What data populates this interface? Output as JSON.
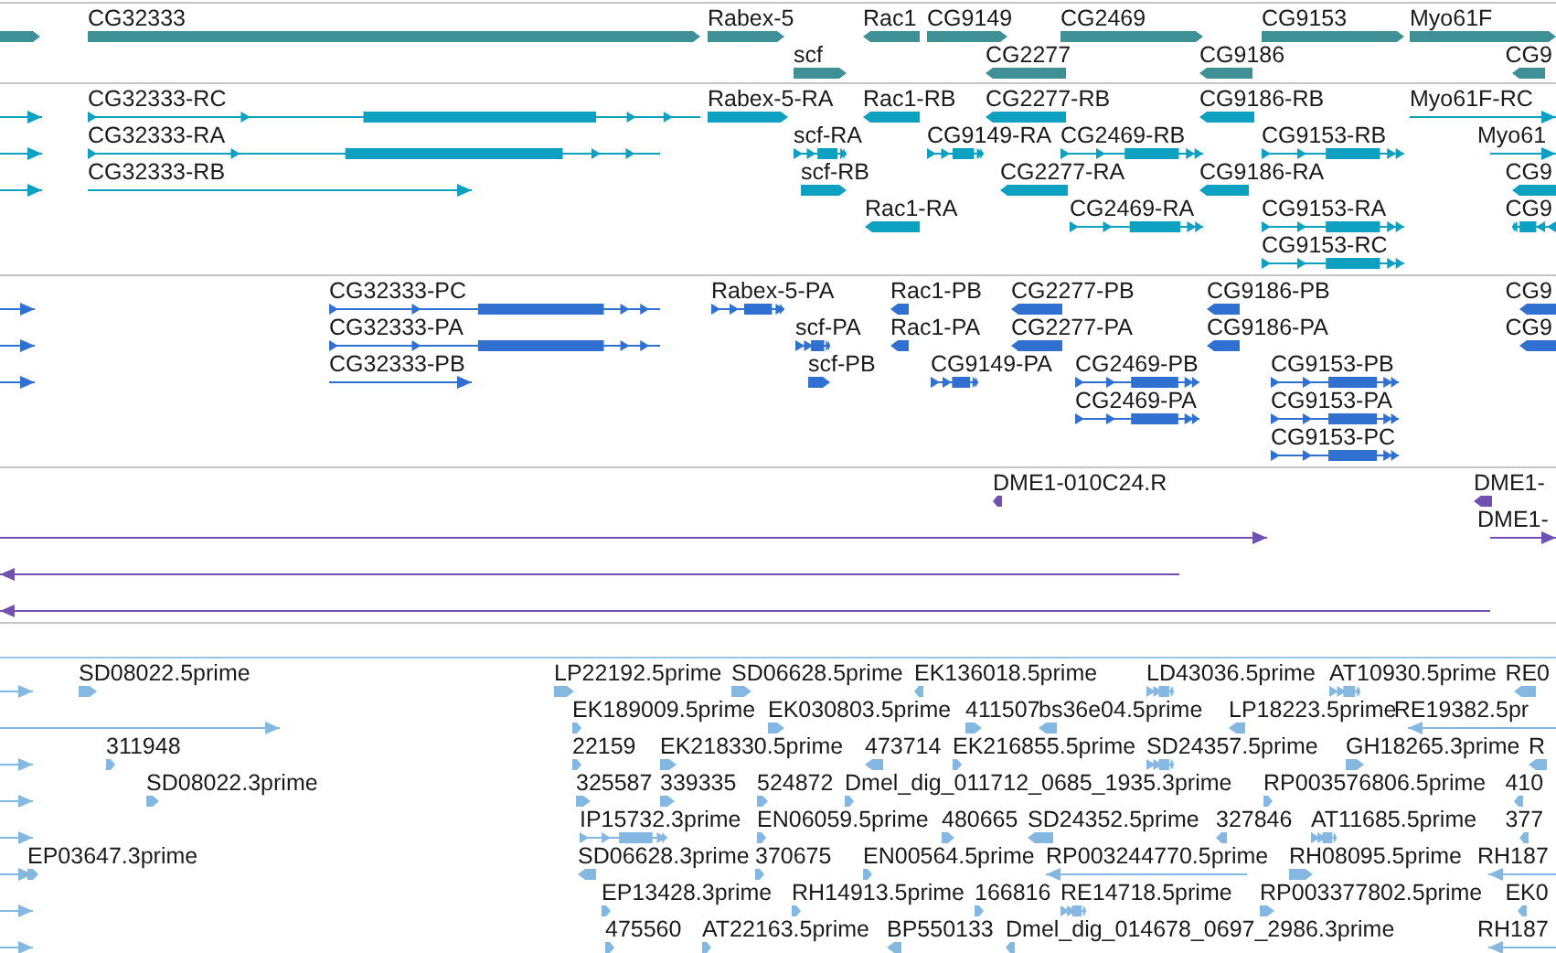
{
  "tracks": [
    {
      "color": "#3f8f96",
      "rows": [
        {
          "features": [
            {
              "kind": "block",
              "reverse": false
            },
            {
              "label": "CG32333",
              "kind": "block",
              "reverse": false
            },
            {
              "label": "Rabex-5",
              "kind": "block",
              "reverse": false
            },
            {
              "label": "Rac1",
              "kind": "block",
              "reverse": true
            },
            {
              "label": "CG9149",
              "kind": "block",
              "reverse": false
            },
            {
              "label": "CG2469",
              "kind": "block",
              "reverse": false
            },
            {
              "label": "CG9153",
              "kind": "block",
              "reverse": false
            },
            {
              "label": "Myo61F",
              "kind": "block",
              "reverse": false
            }
          ]
        },
        {
          "features": [
            {
              "label": "scf",
              "kind": "block",
              "reverse": false
            },
            {
              "label": "CG2277",
              "kind": "block",
              "reverse": true
            },
            {
              "label": "CG9186",
              "kind": "block",
              "reverse": true
            },
            {
              "label": "CG9",
              "kind": "block",
              "reverse": true
            }
          ]
        }
      ]
    },
    {
      "color": "#0ea0c0",
      "rows": [
        {
          "features": [
            {
              "kind": "line",
              "reverse": false
            },
            {
              "label": "CG32333-RC",
              "kind": "spliced",
              "reverse": false
            },
            {
              "label": "Rabex-5-RA",
              "kind": "block",
              "reverse": false
            },
            {
              "label": "Rac1-RB",
              "kind": "block",
              "reverse": true
            },
            {
              "label": "CG2277-RB",
              "kind": "block",
              "reverse": true
            },
            {
              "label": "CG9186-RB",
              "kind": "block",
              "reverse": true
            },
            {
              "label": "Myo61F-RC",
              "kind": "line",
              "reverse": false
            }
          ]
        },
        {
          "features": [
            {
              "kind": "line",
              "reverse": false
            },
            {
              "label": "CG32333-RA",
              "kind": "spliced",
              "reverse": false
            },
            {
              "label": "scf-RA",
              "kind": "spliced",
              "reverse": false
            },
            {
              "label": "CG9149-RA",
              "kind": "spliced",
              "reverse": false
            },
            {
              "label": "CG2469-RB",
              "kind": "spliced",
              "reverse": false
            },
            {
              "label": "CG9153-RB",
              "kind": "spliced",
              "reverse": false
            },
            {
              "label": "Myo61",
              "kind": "line",
              "reverse": false
            }
          ]
        },
        {
          "features": [
            {
              "kind": "line",
              "reverse": false
            },
            {
              "label": "CG32333-RB",
              "kind": "line",
              "reverse": false
            },
            {
              "label": "scf-RB",
              "kind": "block",
              "reverse": false
            },
            {
              "label": "CG2277-RA",
              "kind": "block",
              "reverse": true
            },
            {
              "label": "CG9186-RA",
              "kind": "block",
              "reverse": true
            },
            {
              "label": "CG9",
              "kind": "block",
              "reverse": true
            }
          ]
        },
        {
          "features": [
            {
              "label": "Rac1-RA",
              "kind": "block",
              "reverse": true
            },
            {
              "label": "CG2469-RA",
              "kind": "spliced",
              "reverse": false
            },
            {
              "label": "CG9153-RA",
              "kind": "spliced",
              "reverse": false
            },
            {
              "label": "CG9",
              "kind": "spliced",
              "reverse": true
            }
          ]
        },
        {
          "features": [
            {
              "label": "CG9153-RC",
              "kind": "spliced",
              "reverse": false
            }
          ]
        }
      ]
    },
    {
      "color": "#3070d0",
      "rows": [
        {
          "features": [
            {
              "kind": "line",
              "reverse": false
            },
            {
              "label": "CG32333-PC",
              "kind": "spliced",
              "reverse": false
            },
            {
              "label": "Rabex-5-PA",
              "kind": "spliced",
              "reverse": false
            },
            {
              "label": "Rac1-PB",
              "kind": "block",
              "reverse": true
            },
            {
              "label": "CG2277-PB",
              "kind": "block",
              "reverse": true
            },
            {
              "label": "CG9186-PB",
              "kind": "block",
              "reverse": true
            },
            {
              "label": "CG9",
              "kind": "block",
              "reverse": true
            }
          ]
        },
        {
          "features": [
            {
              "kind": "line",
              "reverse": false
            },
            {
              "label": "CG32333-PA",
              "kind": "spliced",
              "reverse": false
            },
            {
              "label": "scf-PA",
              "kind": "spliced",
              "reverse": false
            },
            {
              "label": "Rac1-PA",
              "kind": "block",
              "reverse": true
            },
            {
              "label": "CG2277-PA",
              "kind": "block",
              "reverse": true
            },
            {
              "label": "CG9186-PA",
              "kind": "block",
              "reverse": true
            },
            {
              "label": "CG9",
              "kind": "block",
              "reverse": true
            }
          ]
        },
        {
          "features": [
            {
              "kind": "line",
              "reverse": false
            },
            {
              "label": "CG32333-PB",
              "kind": "line",
              "reverse": false
            },
            {
              "label": "scf-PB",
              "kind": "block",
              "reverse": false
            },
            {
              "label": "CG9149-PA",
              "kind": "spliced",
              "reverse": false
            },
            {
              "label": "CG2469-PB",
              "kind": "spliced",
              "reverse": false
            },
            {
              "label": "CG9153-PB",
              "kind": "spliced",
              "reverse": false
            }
          ]
        },
        {
          "features": [
            {
              "label": "CG2469-PA",
              "kind": "spliced",
              "reverse": false
            },
            {
              "label": "CG9153-PA",
              "kind": "spliced",
              "reverse": false
            }
          ]
        },
        {
          "features": [
            {
              "label": "CG9153-PC",
              "kind": "spliced",
              "reverse": false
            }
          ]
        }
      ]
    },
    {
      "color": "#7050b0",
      "rows": [
        {
          "features": [
            {
              "label": "DME1-010C24.R",
              "kind": "block",
              "reverse": true
            },
            {
              "label": "DME1-",
              "kind": "block",
              "reverse": true
            }
          ]
        },
        {
          "features": [
            {
              "kind": "line",
              "reverse": false
            },
            {
              "label": "DME1-",
              "kind": "line",
              "reverse": false
            }
          ]
        },
        {
          "features": [
            {
              "kind": "line",
              "reverse": true
            }
          ]
        },
        {
          "features": [
            {
              "kind": "line",
              "reverse": true
            }
          ]
        }
      ]
    },
    {
      "color": "#84b8e0",
      "rows": [
        {
          "features": [
            {
              "kind": "line",
              "reverse": false
            },
            {
              "label": "SD08022.5prime",
              "kind": "block",
              "reverse": false
            },
            {
              "label": "LP22192.5prime",
              "kind": "block",
              "reverse": false
            },
            {
              "label": "SD06628.5prime",
              "kind": "block",
              "reverse": false
            },
            {
              "label": "EK136018.5prime",
              "kind": "block",
              "reverse": true
            },
            {
              "label": "LD43036.5prime",
              "kind": "spliced",
              "reverse": false
            },
            {
              "label": "AT10930.5prime",
              "kind": "spliced",
              "reverse": false
            },
            {
              "label": "RE0",
              "kind": "block",
              "reverse": true
            }
          ]
        },
        {
          "features": [
            {
              "kind": "line",
              "reverse": false
            },
            {
              "label": "EK189009.5prime",
              "kind": "block",
              "reverse": false
            },
            {
              "label": "EK030803.5prime",
              "kind": "block",
              "reverse": false
            },
            {
              "label": "411507",
              "kind": "block",
              "reverse": false
            },
            {
              "label": "bs36e04.5prime",
              "kind": "block",
              "reverse": true
            },
            {
              "label": "LP18223.5prime",
              "kind": "block",
              "reverse": true
            },
            {
              "label": "RE19382.5pr",
              "kind": "line",
              "reverse": true
            }
          ]
        },
        {
          "features": [
            {
              "kind": "line",
              "reverse": false
            },
            {
              "label": "311948",
              "kind": "block",
              "reverse": false
            },
            {
              "label": "22159",
              "kind": "block",
              "reverse": false
            },
            {
              "label": "EK218330.5prime",
              "kind": "block",
              "reverse": false
            },
            {
              "label": "473714",
              "kind": "block",
              "reverse": true
            },
            {
              "label": "EK216855.5prime",
              "kind": "block",
              "reverse": false
            },
            {
              "label": "SD24357.5prime",
              "kind": "spliced",
              "reverse": false
            },
            {
              "label": "GH18265.3prime",
              "kind": "block",
              "reverse": false
            },
            {
              "label": "R",
              "kind": "block",
              "reverse": true
            }
          ]
        },
        {
          "features": [
            {
              "kind": "line",
              "reverse": false
            },
            {
              "label": "SD08022.3prime",
              "kind": "block",
              "reverse": false
            },
            {
              "label": "325587",
              "kind": "block",
              "reverse": false
            },
            {
              "label": "339335",
              "kind": "block",
              "reverse": false
            },
            {
              "label": "524872",
              "kind": "block",
              "reverse": false
            },
            {
              "label": "Dmel_dig_011712_0685_1935.3prime",
              "kind": "block",
              "reverse": false
            },
            {
              "label": "RP003576806.5prime",
              "kind": "block",
              "reverse": false
            },
            {
              "label": "410",
              "kind": "block",
              "reverse": true
            }
          ]
        },
        {
          "features": [
            {
              "kind": "line",
              "reverse": false
            },
            {
              "label": "IP15732.3prime",
              "kind": "spliced",
              "reverse": false
            },
            {
              "label": "EN06059.5prime",
              "kind": "block",
              "reverse": false
            },
            {
              "label": "480665",
              "kind": "block",
              "reverse": false
            },
            {
              "label": "SD24352.5prime",
              "kind": "block",
              "reverse": true
            },
            {
              "label": "327846",
              "kind": "block",
              "reverse": true
            },
            {
              "label": "AT11685.5prime",
              "kind": "spliced",
              "reverse": false
            },
            {
              "label": "377",
              "kind": "block",
              "reverse": true
            }
          ]
        },
        {
          "features": [
            {
              "kind": "line",
              "reverse": false
            },
            {
              "label": "EP03647.3prime",
              "kind": "block",
              "reverse": false
            },
            {
              "label": "SD06628.3prime",
              "kind": "block",
              "reverse": true
            },
            {
              "label": "370675",
              "kind": "block",
              "reverse": false
            },
            {
              "label": "EN00564.5prime",
              "kind": "block",
              "reverse": false
            },
            {
              "label": "RP003244770.5prime",
              "kind": "line",
              "reverse": true
            },
            {
              "label": "RH08095.5prime",
              "kind": "block",
              "reverse": false
            },
            {
              "label": "RH187",
              "kind": "line",
              "reverse": true
            }
          ]
        },
        {
          "features": [
            {
              "kind": "line",
              "reverse": false
            },
            {
              "label": "EP13428.3prime",
              "kind": "block",
              "reverse": false
            },
            {
              "label": "RH14913.5prime",
              "kind": "block",
              "reverse": false
            },
            {
              "label": "166816",
              "kind": "block",
              "reverse": false
            },
            {
              "label": "RE14718.5prime",
              "kind": "spliced",
              "reverse": false
            },
            {
              "label": "RP003377802.5prime",
              "kind": "block",
              "reverse": false
            },
            {
              "label": "EK0",
              "kind": "block",
              "reverse": true
            }
          ]
        },
        {
          "features": [
            {
              "kind": "line",
              "reverse": false
            },
            {
              "label": "475560",
              "kind": "block",
              "reverse": false
            },
            {
              "label": "AT22163.5prime",
              "kind": "block",
              "reverse": false
            },
            {
              "label": "BP550133",
              "kind": "block",
              "reverse": true
            },
            {
              "label": "Dmel_dig_014678_0697_2986.3prime",
              "kind": "block",
              "reverse": true
            },
            {
              "label": "RH187",
              "kind": "line",
              "reverse": true
            }
          ]
        }
      ]
    }
  ]
}
